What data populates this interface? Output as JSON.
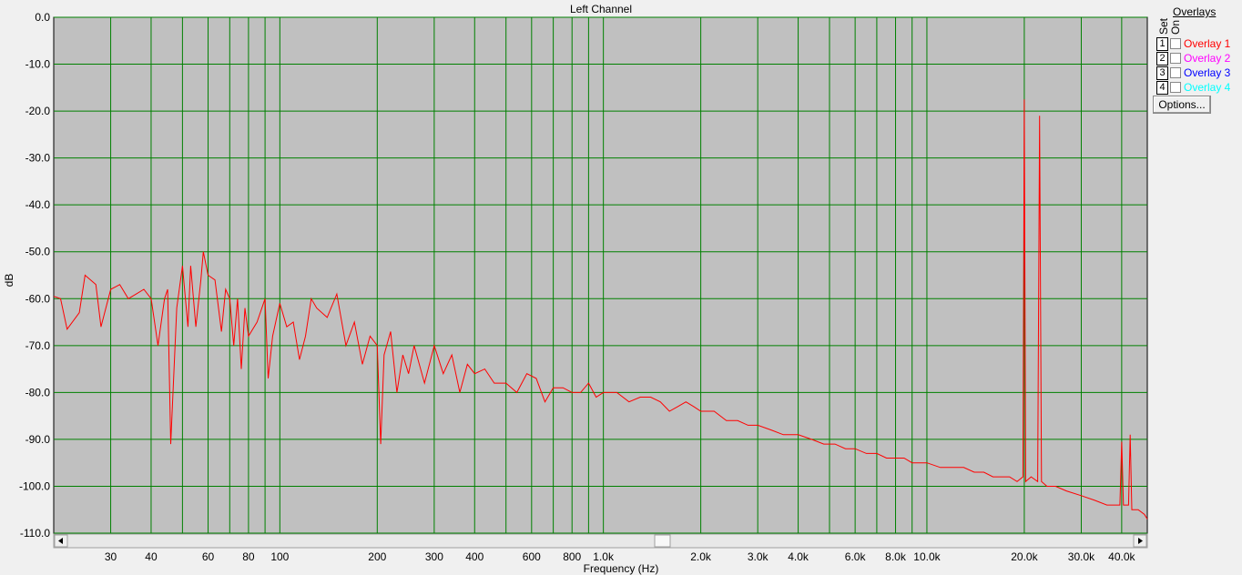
{
  "window_title": "Left Channel",
  "chart_data": {
    "type": "line",
    "title": "Left Channel",
    "xlabel": "Frequency (Hz)",
    "ylabel": "dB",
    "xscale": "log",
    "xlim": [
      20,
      48000
    ],
    "ylim": [
      -110,
      0
    ],
    "grid": true,
    "x_ticks": [
      {
        "v": 30,
        "label": "30"
      },
      {
        "v": 40,
        "label": "40"
      },
      {
        "v": 60,
        "label": "60"
      },
      {
        "v": 80,
        "label": "80"
      },
      {
        "v": 100,
        "label": "100"
      },
      {
        "v": 200,
        "label": "200"
      },
      {
        "v": 300,
        "label": "300"
      },
      {
        "v": 400,
        "label": "400"
      },
      {
        "v": 600,
        "label": "600"
      },
      {
        "v": 800,
        "label": "800"
      },
      {
        "v": 1000,
        "label": "1.0k"
      },
      {
        "v": 2000,
        "label": "2.0k"
      },
      {
        "v": 3000,
        "label": "3.0k"
      },
      {
        "v": 4000,
        "label": "4.0k"
      },
      {
        "v": 6000,
        "label": "6.0k"
      },
      {
        "v": 8000,
        "label": "8.0k"
      },
      {
        "v": 10000,
        "label": "10.0k"
      },
      {
        "v": 20000,
        "label": "20.0k"
      },
      {
        "v": 30000,
        "label": "30.0k"
      },
      {
        "v": 40000,
        "label": "40.0k"
      }
    ],
    "x_gridlines": [
      30,
      40,
      50,
      60,
      70,
      80,
      90,
      100,
      200,
      300,
      400,
      500,
      600,
      700,
      800,
      900,
      1000,
      2000,
      3000,
      4000,
      5000,
      6000,
      7000,
      8000,
      9000,
      10000,
      20000,
      30000,
      40000
    ],
    "y_ticks": [
      {
        "v": 0,
        "label": "0.0"
      },
      {
        "v": -10,
        "label": "-10.0"
      },
      {
        "v": -20,
        "label": "-20.0"
      },
      {
        "v": -30,
        "label": "-30.0"
      },
      {
        "v": -40,
        "label": "-40.0"
      },
      {
        "v": -50,
        "label": "-50.0"
      },
      {
        "v": -60,
        "label": "-60.0"
      },
      {
        "v": -70,
        "label": "-70.0"
      },
      {
        "v": -80,
        "label": "-80.0"
      },
      {
        "v": -90,
        "label": "-90.0"
      },
      {
        "v": -100,
        "label": "-100.0"
      },
      {
        "v": -110,
        "label": "-110.0"
      }
    ],
    "series": [
      {
        "color": "#ff0000",
        "x": [
          20,
          21,
          22,
          24,
          25,
          27,
          28,
          30,
          32,
          34,
          36,
          38,
          40,
          42,
          44,
          45,
          46,
          48,
          50,
          52,
          53,
          55,
          57,
          58,
          60,
          63,
          66,
          68,
          70,
          72,
          74,
          76,
          78,
          80,
          85,
          90,
          92,
          95,
          100,
          105,
          110,
          115,
          120,
          125,
          130,
          140,
          150,
          160,
          170,
          180,
          190,
          200,
          205,
          210,
          220,
          230,
          240,
          250,
          260,
          280,
          300,
          320,
          340,
          360,
          380,
          400,
          430,
          460,
          500,
          540,
          580,
          620,
          660,
          700,
          750,
          800,
          850,
          900,
          950,
          1000,
          1100,
          1200,
          1300,
          1400,
          1500,
          1600,
          1700,
          1800,
          1900,
          2000,
          2200,
          2400,
          2600,
          2800,
          3000,
          3300,
          3600,
          4000,
          4400,
          4800,
          5200,
          5600,
          6000,
          6500,
          7000,
          7500,
          8000,
          8500,
          9000,
          10000,
          11000,
          12000,
          13000,
          14000,
          15000,
          16000,
          17000,
          18000,
          19000,
          19800,
          20000,
          20200,
          21000,
          22000,
          22300,
          22600,
          23500,
          25000,
          27000,
          30000,
          33000,
          36000,
          38000,
          39500,
          40000,
          40500,
          42000,
          42500,
          43000,
          45000,
          47000,
          48000
        ],
        "y": [
          -59.5,
          -60,
          -66.5,
          -63,
          -55,
          -57,
          -66,
          -58,
          -57,
          -60,
          -59,
          -58,
          -60,
          -70,
          -60,
          -58,
          -91,
          -62,
          -53,
          -66,
          -53,
          -66,
          -56,
          -50,
          -55,
          -56,
          -67,
          -58,
          -60,
          -70,
          -60,
          -75,
          -62,
          -68,
          -65,
          -60,
          -77,
          -68,
          -61,
          -66,
          -65,
          -73,
          -68,
          -60,
          -62,
          -64,
          -59,
          -70,
          -65,
          -74,
          -68,
          -70,
          -91,
          -72,
          -67,
          -80,
          -72,
          -76,
          -70,
          -78,
          -70,
          -76,
          -72,
          -80,
          -74,
          -76,
          -75,
          -78,
          -78,
          -80,
          -76,
          -77,
          -82,
          -79,
          -79,
          -80,
          -80,
          -78,
          -81,
          -80,
          -80,
          -82,
          -81,
          -81,
          -82,
          -84,
          -83,
          -82,
          -83,
          -84,
          -84,
          -86,
          -86,
          -87,
          -87,
          -88,
          -89,
          -89,
          -90,
          -91,
          -91,
          -92,
          -92,
          -93,
          -93,
          -94,
          -94,
          -94,
          -95,
          -95,
          -96,
          -96,
          -96,
          -97,
          -97,
          -98,
          -98,
          -98,
          -99,
          -98,
          -17.5,
          -99,
          -98,
          -99,
          -21,
          -99,
          -100,
          -100,
          -101,
          -102,
          -103,
          -104,
          -104,
          -104,
          -90.5,
          -104,
          -104,
          -89,
          -105,
          -105,
          -106,
          -107
        ]
      }
    ]
  },
  "overlays": {
    "title": "Overlays",
    "set_label": "Set",
    "on_label": "On",
    "items": [
      {
        "num": "1",
        "label": "Overlay 1",
        "color": "#ff0000"
      },
      {
        "num": "2",
        "label": "Overlay 2",
        "color": "#ff00ff"
      },
      {
        "num": "3",
        "label": "Overlay 3",
        "color": "#0000ff"
      },
      {
        "num": "4",
        "label": "Overlay 4",
        "color": "#00ffff"
      }
    ],
    "options_label": "Options..."
  }
}
